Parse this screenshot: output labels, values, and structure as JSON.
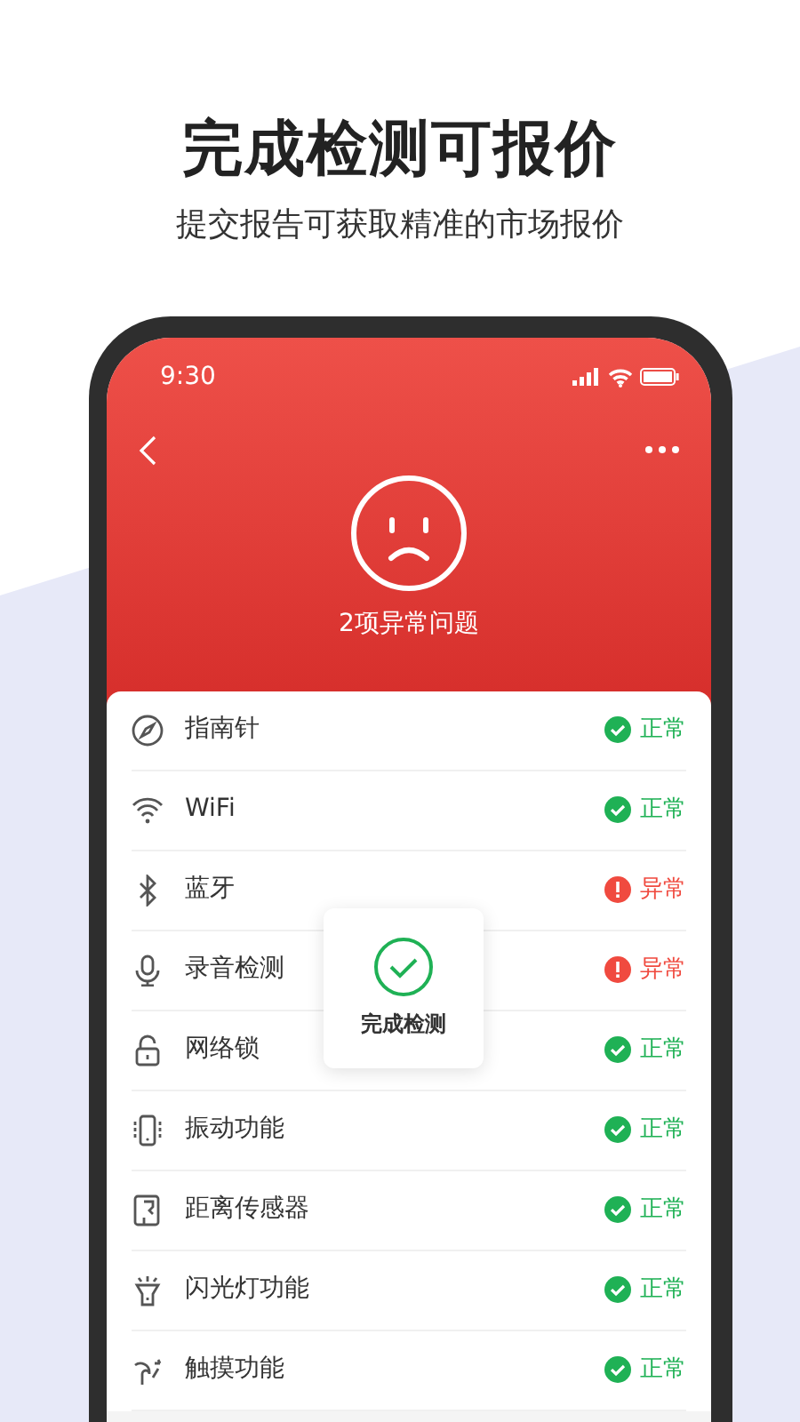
{
  "headline": "完成检测可报价",
  "subtitle": "提交报告可获取精准的市场报价",
  "status_bar": {
    "time": "9:30"
  },
  "summary": "2项异常问题",
  "checks": [
    {
      "label": "指南针",
      "status": "正常",
      "abnormal": false
    },
    {
      "label": "WiFi",
      "status": "正常",
      "abnormal": false
    },
    {
      "label": "蓝牙",
      "status": "异常",
      "abnormal": true
    },
    {
      "label": "录音检测",
      "status": "异常",
      "abnormal": true
    },
    {
      "label": "网络锁",
      "status": "正常",
      "abnormal": false
    },
    {
      "label": "振动功能",
      "status": "正常",
      "abnormal": false
    },
    {
      "label": "距离传感器",
      "status": "正常",
      "abnormal": false
    },
    {
      "label": "闪光灯功能",
      "status": "正常",
      "abnormal": false
    },
    {
      "label": "触摸功能",
      "status": "正常",
      "abnormal": false
    }
  ],
  "toast": {
    "text": "完成检测"
  }
}
